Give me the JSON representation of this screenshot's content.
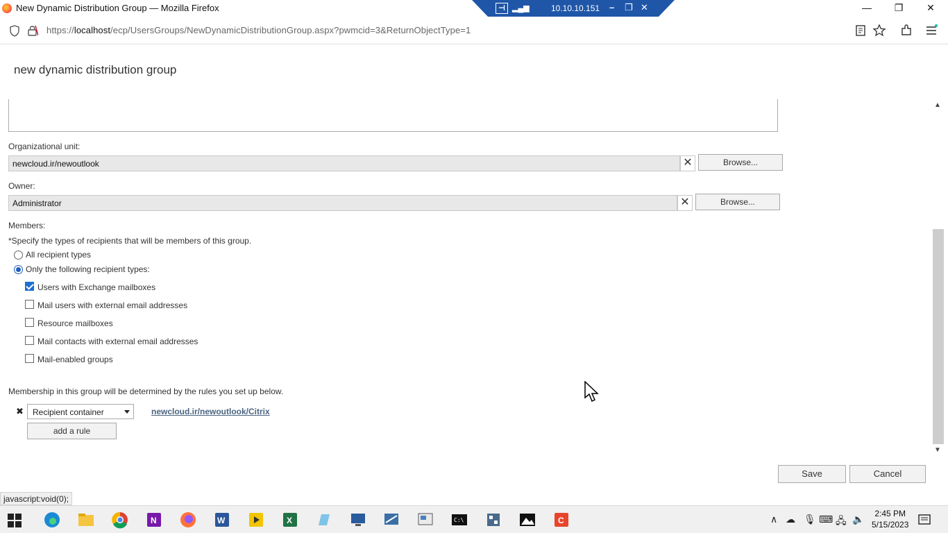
{
  "window": {
    "title": "New Dynamic Distribution Group — Mozilla Firefox",
    "minimize_glyph": "—",
    "restore_glyph": "❐",
    "close_glyph": "✕"
  },
  "remote_bar": {
    "ip": "10.10.10.151"
  },
  "browser": {
    "url_prefix": "https://",
    "url_host": "localhost",
    "url_path": "/ecp/UsersGroups/NewDynamicDistributionGroup.aspx?pwmcid=3&ReturnObjectType=1"
  },
  "page": {
    "title": "new dynamic distribution group"
  },
  "form": {
    "org_unit_label": "Organizational unit:",
    "org_unit_value": "newcloud.ir/newoutlook",
    "owner_label": "Owner:",
    "owner_value": "Administrator",
    "browse_label": "Browse...",
    "clear_glyph": "✕",
    "members_label": "Members:",
    "members_hint": "*Specify the types of recipients that will be members of this group.",
    "radio_all": "All recipient types",
    "radio_only": "Only the following recipient types:",
    "recipient_types": [
      {
        "label": "Users with Exchange mailboxes",
        "checked": true
      },
      {
        "label": "Mail users with external email addresses",
        "checked": false
      },
      {
        "label": "Resource mailboxes",
        "checked": false
      },
      {
        "label": "Mail contacts with external email addresses",
        "checked": false
      },
      {
        "label": "Mail-enabled groups",
        "checked": false
      }
    ],
    "rules_hint": "Membership in this group will be determined by the rules you set up below.",
    "rule_remove_glyph": "✖",
    "rule_type": "Recipient container",
    "rule_value": "newcloud.ir/newoutlook/Citrix",
    "add_rule_label": "add a rule"
  },
  "actions": {
    "save_label": "Save",
    "cancel_label": "Cancel"
  },
  "status_bar": {
    "text": "javascript:void(0);"
  },
  "taskbar": {
    "time": "2:45 PM",
    "date": "5/15/2023"
  }
}
